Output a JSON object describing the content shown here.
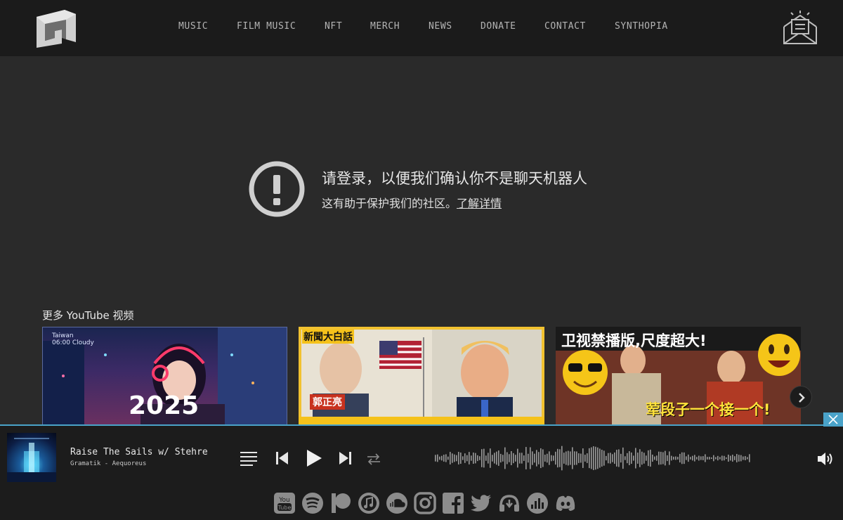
{
  "nav": {
    "items": [
      {
        "label": "MUSIC"
      },
      {
        "label": "FILM MUSIC"
      },
      {
        "label": "NFT"
      },
      {
        "label": "MERCH"
      },
      {
        "label": "NEWS"
      },
      {
        "label": "DONATE"
      },
      {
        "label": "CONTACT"
      },
      {
        "label": "SYNTHOPIA"
      }
    ]
  },
  "notice": {
    "title": "请登录，以便我们确认你不是聊天机器人",
    "subtitle": "这有助于保护我们的社区。",
    "link": "了解详情"
  },
  "videos": {
    "section_title": "更多 YouTube 视频",
    "items": [
      {
        "overlay_text": "2025",
        "badge_location": "Taiwan",
        "badge_time": "06:00",
        "badge_weather": "Cloudy"
      },
      {
        "overlay_text": "新聞大白話",
        "name_tag": "郭正亮"
      },
      {
        "overlay_text": "卫视禁播版,尺度超大!",
        "caption": "荤段子一个接一个!"
      }
    ]
  },
  "player": {
    "track_title": "Raise The Sails w/ Stehre",
    "track_artist": "Gramatik - Aequoreus",
    "accent_color": "#4aa3c9",
    "controls": [
      "playlist-icon",
      "previous-icon",
      "play-icon",
      "next-icon",
      "repeat-icon",
      "volume-icon"
    ]
  },
  "social_links": [
    "youtube-icon",
    "spotify-icon",
    "patreon-icon",
    "apple-music-icon",
    "soundcloud-icon",
    "instagram-icon",
    "facebook-icon",
    "twitter-icon",
    "audiomack-icon",
    "deezer-icon",
    "discord-icon"
  ]
}
